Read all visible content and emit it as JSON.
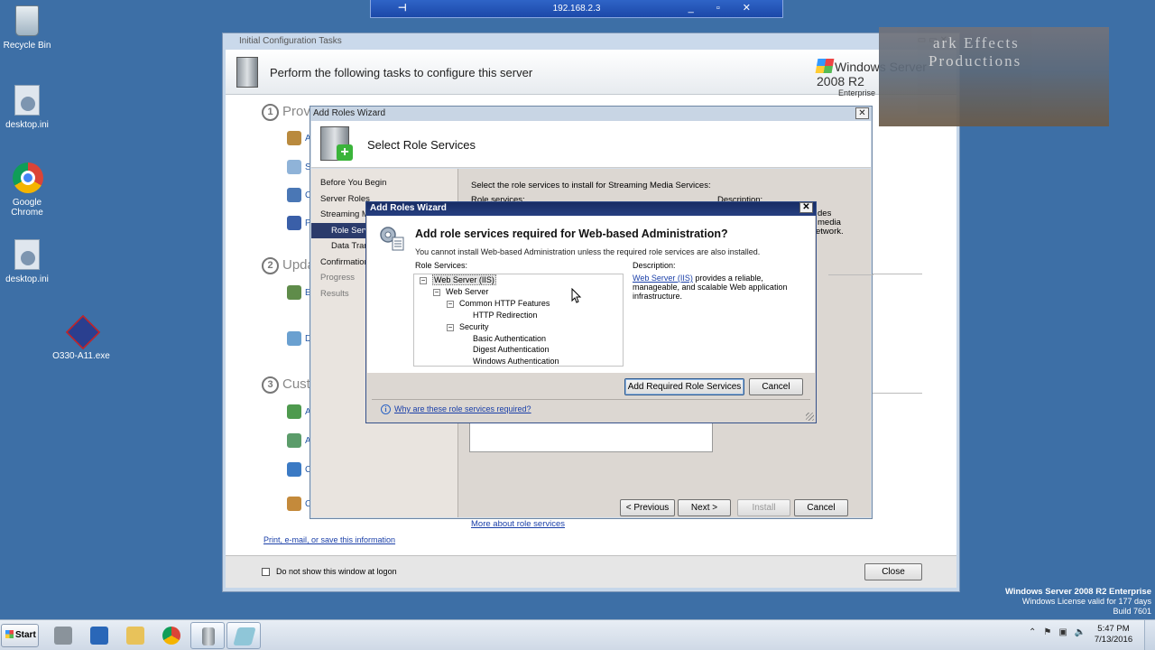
{
  "rdp": {
    "title": "192.168.2.3",
    "pin": "⊣",
    "controls": "_ ▫ ✕"
  },
  "desktop": {
    "icons": [
      {
        "label": "Recycle Bin"
      },
      {
        "label": "desktop.ini"
      },
      {
        "label": "Google Chrome"
      },
      {
        "label": "desktop.ini"
      },
      {
        "label": "O330-A11.exe"
      }
    ]
  },
  "watermark": {
    "line1": "ark Effects",
    "line2": "Productions"
  },
  "ict": {
    "title": "Initial Configuration Tasks",
    "header": "Perform the following tasks to configure this server",
    "logo_main": "Windows Server 2008 R2",
    "logo_sub": "Enterprise",
    "sections": [
      {
        "num": "1",
        "label": "Prov"
      },
      {
        "num": "2",
        "label": "Upda"
      },
      {
        "num": "3",
        "label": "Cust"
      }
    ],
    "task_letters": [
      "A",
      "S",
      "C",
      "P",
      "E",
      "D",
      "A",
      "A",
      "C",
      "C"
    ],
    "print_link": "Print, e-mail, or save this information",
    "checkbox_label": "Do not show this window at logon",
    "close_button": "Close"
  },
  "wizard": {
    "title": "Add Roles Wizard",
    "heading": "Select Role Services",
    "steps": [
      {
        "label": "Before You Begin",
        "state": "normal"
      },
      {
        "label": "Server Roles",
        "state": "normal"
      },
      {
        "label": "Streaming Me",
        "state": "normal"
      },
      {
        "label": "Role Servi",
        "state": "active"
      },
      {
        "label": "Data Tran",
        "state": "sub"
      },
      {
        "label": "Confirmation",
        "state": "normal"
      },
      {
        "label": "Progress",
        "state": "dim"
      },
      {
        "label": "Results",
        "state": "dim"
      }
    ],
    "instructions": "Select the role services to install for Streaming Media Services:",
    "role_services_label": "Role services:",
    "description_label": "Description:",
    "desc_fragment_1": "des",
    "desc_fragment_2": "media",
    "desc_fragment_3": "etwork.",
    "more_link": "More about role services",
    "buttons": {
      "previous": "< Previous",
      "next": "Next >",
      "install": "Install",
      "cancel": "Cancel"
    }
  },
  "dialog": {
    "title": "Add Roles Wizard",
    "question": "Add role services required for Web-based Administration?",
    "message": "You cannot install Web-based Administration unless the required role services are also installed.",
    "role_services_label": "Role Services:",
    "tree": [
      {
        "label": "Web Server (IIS)",
        "toggle": "−"
      },
      {
        "label": "Web Server",
        "toggle": "−"
      },
      {
        "label": "Common HTTP Features",
        "toggle": "−"
      },
      {
        "label": "HTTP Redirection",
        "toggle": ""
      },
      {
        "label": "Security",
        "toggle": "−"
      },
      {
        "label": "Basic Authentication",
        "toggle": ""
      },
      {
        "label": "Digest Authentication",
        "toggle": ""
      },
      {
        "label": "Windows Authentication",
        "toggle": ""
      }
    ],
    "description_label": "Description:",
    "description_link": "Web Server (IIS)",
    "description_text": " provides a reliable, manageable, and scalable Web application infrastructure.",
    "add_button": "Add Required Role Services",
    "cancel_button": "Cancel",
    "help_link": "Why are these role services required?"
  },
  "server_info": {
    "line1": "Windows Server 2008 R2 Enterprise",
    "line2": "Windows License valid for 177 days",
    "line3": "Build 7601"
  },
  "taskbar": {
    "start": "Start",
    "time": "5:47 PM",
    "date": "7/13/2016"
  }
}
